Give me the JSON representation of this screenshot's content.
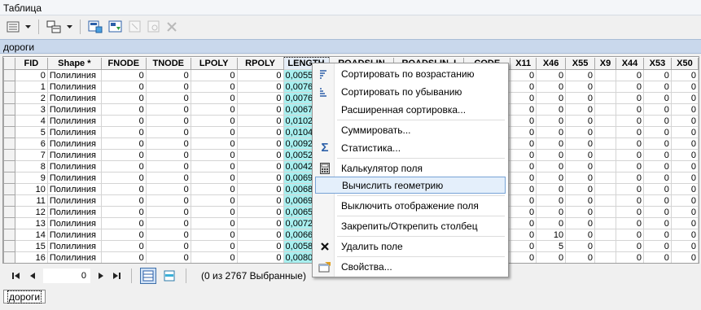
{
  "window": {
    "title": "Таблица"
  },
  "toolbar": {
    "icons": [
      "table-options-icon",
      "dropdown-arrow-icon",
      "related-tables-icon",
      "dropdown-arrow-icon",
      "select-by-attributes-icon",
      "switch-selection-icon",
      "clear-selection-icon",
      "zoom-to-selected-icon",
      "delete-selected-icon"
    ]
  },
  "table": {
    "name": "дороги",
    "columns": [
      "FID",
      "Shape *",
      "FNODE",
      "TNODE",
      "LPOLY",
      "RPOLY",
      "LENGTH",
      "ROADSLIN",
      "ROADSLIN_I",
      "CODE",
      "X11",
      "X46",
      "X55",
      "X9",
      "X44",
      "X53",
      "X50"
    ],
    "rows": [
      [
        "0",
        "Полилиния",
        "0",
        "0",
        "0",
        "0",
        "0,005559",
        "",
        "",
        "",
        "0",
        "0",
        "0",
        "",
        "0",
        "0",
        "0"
      ],
      [
        "1",
        "Полилиния",
        "0",
        "0",
        "0",
        "0",
        "0,0076",
        "",
        "",
        "",
        "0",
        "0",
        "0",
        "",
        "0",
        "0",
        "0"
      ],
      [
        "2",
        "Полилиния",
        "0",
        "0",
        "0",
        "0",
        "0,0076",
        "",
        "",
        "",
        "0",
        "0",
        "0",
        "",
        "0",
        "0",
        "0"
      ],
      [
        "3",
        "Полилиния",
        "0",
        "0",
        "0",
        "0",
        "0,00678",
        "",
        "",
        "",
        "0",
        "0",
        "0",
        "",
        "0",
        "0",
        "0"
      ],
      [
        "4",
        "Полилиния",
        "0",
        "0",
        "0",
        "0",
        "0,01028",
        "",
        "",
        "",
        "0",
        "0",
        "0",
        "",
        "0",
        "0",
        "0"
      ],
      [
        "5",
        "Полилиния",
        "0",
        "0",
        "0",
        "0",
        "0,01047",
        "",
        "",
        "",
        "0",
        "0",
        "0",
        "",
        "0",
        "0",
        "0"
      ],
      [
        "6",
        "Полилиния",
        "0",
        "0",
        "0",
        "0",
        "0,00924",
        "",
        "",
        "",
        "0",
        "0",
        "0",
        "",
        "0",
        "0",
        "0"
      ],
      [
        "7",
        "Полилиния",
        "0",
        "0",
        "0",
        "0",
        "0,00528",
        "",
        "",
        "",
        "0",
        "0",
        "0",
        "",
        "0",
        "0",
        "0"
      ],
      [
        "8",
        "Полилиния",
        "0",
        "0",
        "0",
        "0",
        "0,00429",
        "",
        "",
        "",
        "0",
        "0",
        "0",
        "",
        "0",
        "0",
        "0"
      ],
      [
        "9",
        "Полилиния",
        "0",
        "0",
        "0",
        "0",
        "0,00697",
        "",
        "",
        "",
        "0",
        "0",
        "0",
        "",
        "0",
        "0",
        "0"
      ],
      [
        "10",
        "Полилиния",
        "0",
        "0",
        "0",
        "0",
        "0,00686",
        "",
        "",
        "",
        "0",
        "0",
        "0",
        "",
        "0",
        "0",
        "0"
      ],
      [
        "11",
        "Полилиния",
        "0",
        "0",
        "0",
        "0",
        "0,00694",
        "",
        "",
        "",
        "0",
        "0",
        "0",
        "",
        "0",
        "0",
        "0"
      ],
      [
        "12",
        "Полилиния",
        "0",
        "0",
        "0",
        "0",
        "0,00652",
        "",
        "",
        "",
        "0",
        "0",
        "0",
        "",
        "0",
        "0",
        "0"
      ],
      [
        "13",
        "Полилиния",
        "0",
        "0",
        "0",
        "0",
        "0,00722",
        "",
        "",
        "",
        "0",
        "0",
        "0",
        "",
        "0",
        "0",
        "0"
      ],
      [
        "14",
        "Полилиния",
        "0",
        "0",
        "0",
        "0",
        "0,00660",
        "",
        "",
        "",
        "0",
        "10",
        "0",
        "",
        "0",
        "0",
        "0"
      ],
      [
        "15",
        "Полилиния",
        "0",
        "0",
        "0",
        "0",
        "0,00584",
        "",
        "",
        "",
        "0",
        "5",
        "0",
        "",
        "0",
        "0",
        "0"
      ],
      [
        "16",
        "Полилиния",
        "0",
        "0",
        "0",
        "0",
        "0,00806",
        "",
        "",
        "",
        "0",
        "0",
        "0",
        "",
        "0",
        "0",
        "0"
      ]
    ]
  },
  "context_menu": {
    "items": [
      {
        "label": "Сортировать по возрастанию",
        "icon": "sort-ascending-icon"
      },
      {
        "label": "Сортировать по убыванию",
        "icon": "sort-descending-icon"
      },
      {
        "label": "Расширенная сортировка...",
        "icon": ""
      },
      {
        "label": "Суммировать...",
        "icon": ""
      },
      {
        "label": "Статистика...",
        "icon": "sigma-icon"
      },
      {
        "label": "Калькулятор поля",
        "icon": "calculator-icon"
      },
      {
        "label": "Вычислить геометрию",
        "icon": ""
      },
      {
        "label": "Выключить отображение поля",
        "icon": ""
      },
      {
        "label": "Закрепить/Открепить столбец",
        "icon": ""
      },
      {
        "label": "Удалить поле",
        "icon": "delete-x-icon"
      },
      {
        "label": "Свойства...",
        "icon": "properties-icon"
      }
    ],
    "highlighted": "Вычислить геометрию"
  },
  "navigation": {
    "current_record": "0",
    "status": "(0 из 2767 Выбранные)"
  },
  "bottom_tab": {
    "label": "дороги"
  },
  "colors": {
    "accent": "#77a3d6",
    "selected_column": "#a8f0f0",
    "table_header": "#c9d8ec"
  }
}
